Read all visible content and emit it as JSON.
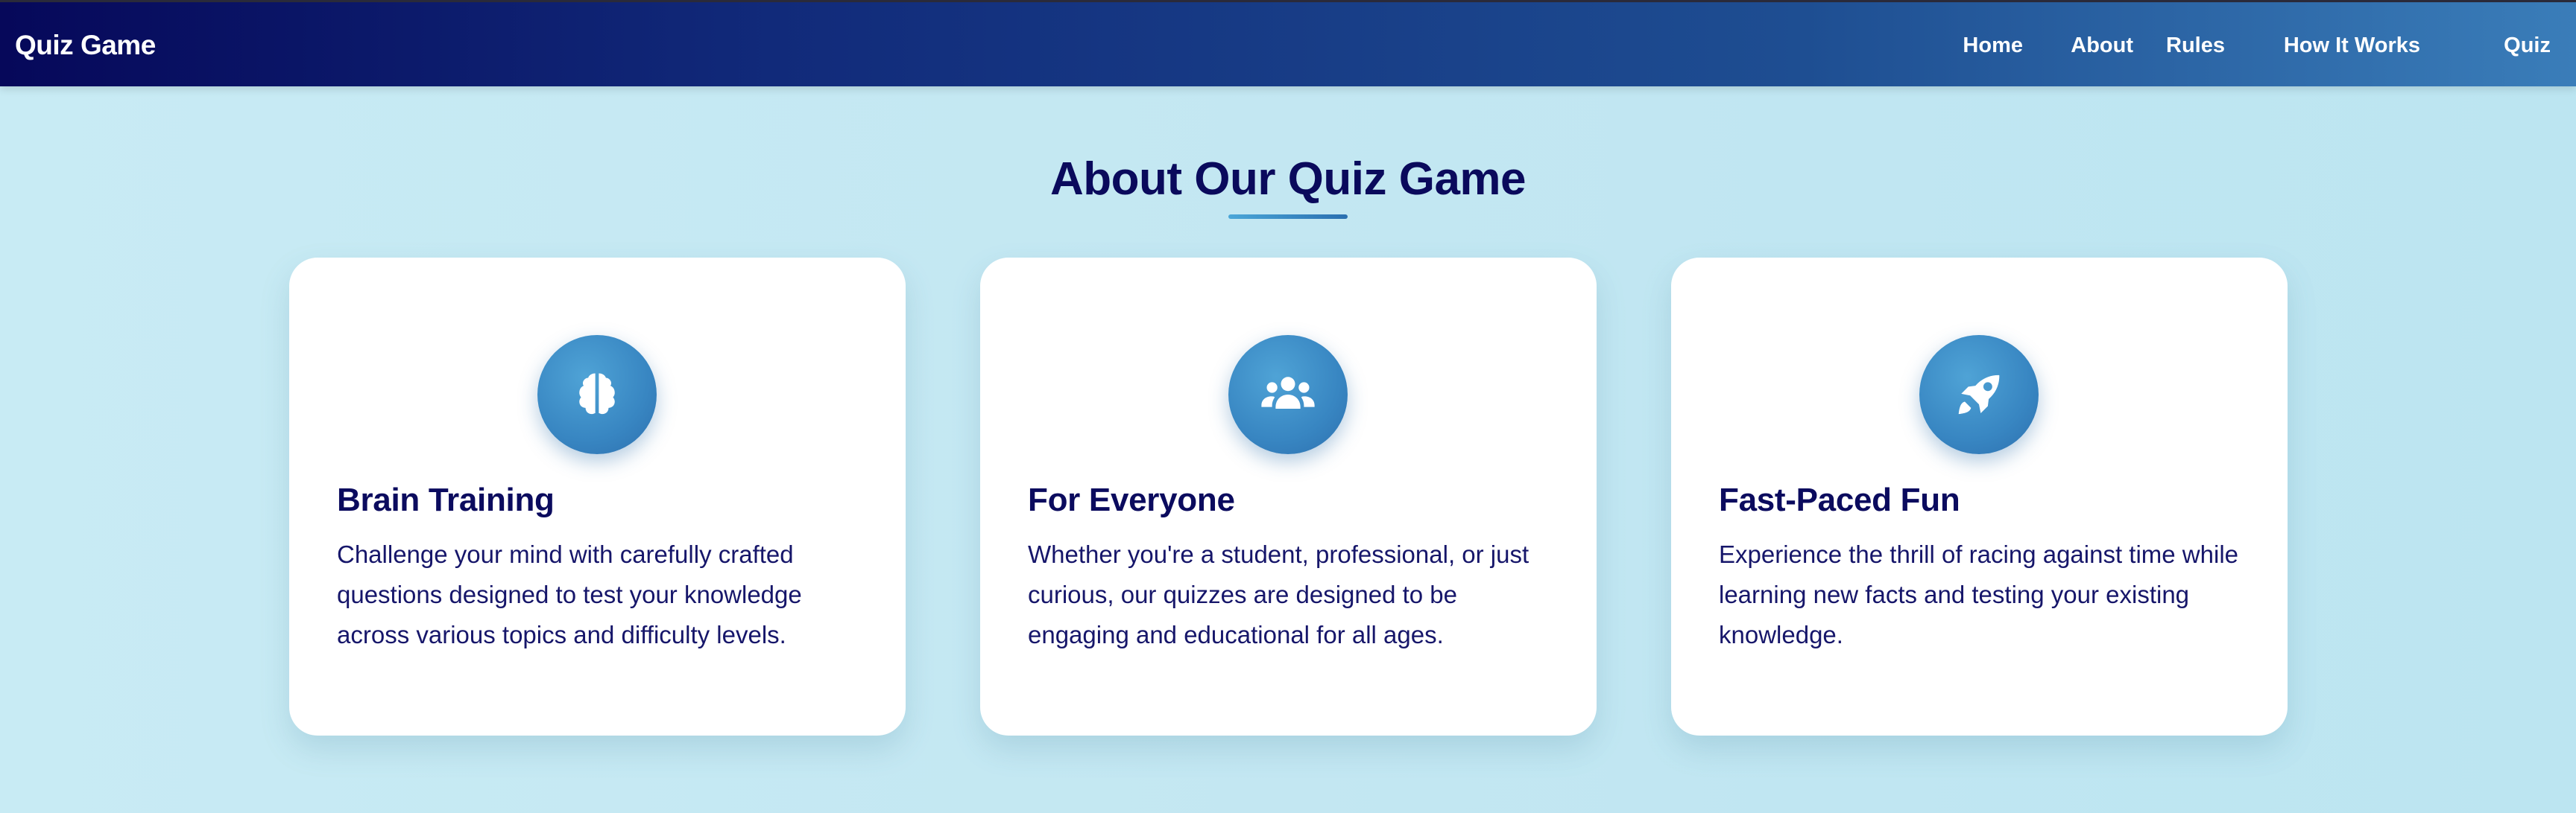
{
  "navbar": {
    "brand": "Quiz Game",
    "links": [
      {
        "label": "Home"
      },
      {
        "label": "About"
      },
      {
        "label": "Rules"
      },
      {
        "label": "How It Works"
      },
      {
        "label": "Quiz"
      }
    ]
  },
  "about": {
    "title": "About Our Quiz Game",
    "cards": [
      {
        "icon": "brain-icon",
        "title": "Brain Training",
        "text": "Challenge your mind with carefully crafted questions designed to test your knowledge across various topics and difficulty levels."
      },
      {
        "icon": "users-icon",
        "title": "For Everyone",
        "text": "Whether you're a student, professional, or just curious, our quizzes are designed to be engaging and educational for all ages."
      },
      {
        "icon": "rocket-icon",
        "title": "Fast-Paced Fun",
        "text": "Experience the thrill of racing against time while learning new facts and testing your existing knowledge."
      }
    ]
  },
  "colors": {
    "nav_start": "#06085a",
    "nav_end": "#3a7db9",
    "heading": "#0a0a5c",
    "accent": "#3886c2",
    "background": "#c5e9f3"
  }
}
